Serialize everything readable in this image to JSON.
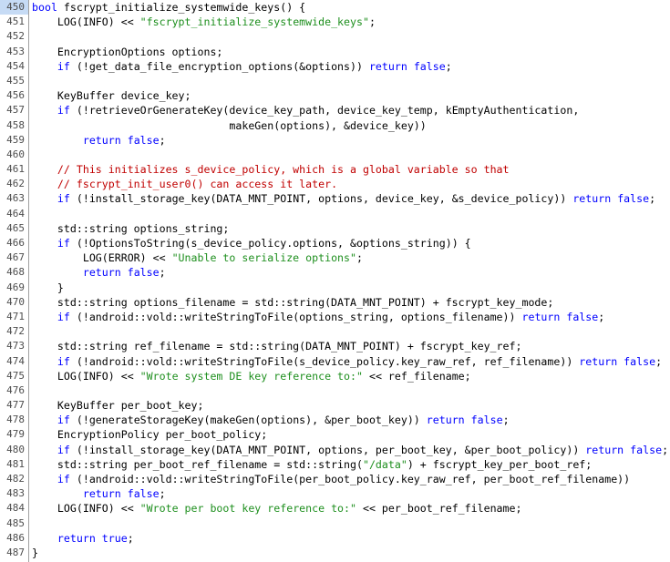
{
  "editor": {
    "current_line": "450",
    "lines": [
      {
        "num": "450",
        "tokens": [
          {
            "t": "kw",
            "v": "bool"
          },
          {
            "t": "p",
            "v": " fscrypt_initialize_systemwide_keys() {"
          }
        ]
      },
      {
        "num": "451",
        "tokens": [
          {
            "t": "p",
            "v": "    LOG(INFO) << "
          },
          {
            "t": "str",
            "v": "\"fscrypt_initialize_systemwide_keys\""
          },
          {
            "t": "p",
            "v": ";"
          }
        ]
      },
      {
        "num": "452",
        "tokens": []
      },
      {
        "num": "453",
        "tokens": [
          {
            "t": "p",
            "v": "    EncryptionOptions options;"
          }
        ]
      },
      {
        "num": "454",
        "tokens": [
          {
            "t": "p",
            "v": "    "
          },
          {
            "t": "kw",
            "v": "if"
          },
          {
            "t": "p",
            "v": " (!get_data_file_encryption_options(&options)) "
          },
          {
            "t": "kw",
            "v": "return"
          },
          {
            "t": "p",
            "v": " "
          },
          {
            "t": "kw",
            "v": "false"
          },
          {
            "t": "p",
            "v": ";"
          }
        ]
      },
      {
        "num": "455",
        "tokens": []
      },
      {
        "num": "456",
        "tokens": [
          {
            "t": "p",
            "v": "    KeyBuffer device_key;"
          }
        ]
      },
      {
        "num": "457",
        "tokens": [
          {
            "t": "p",
            "v": "    "
          },
          {
            "t": "kw",
            "v": "if"
          },
          {
            "t": "p",
            "v": " (!retrieveOrGenerateKey(device_key_path, device_key_temp, kEmptyAuthentication,"
          }
        ]
      },
      {
        "num": "458",
        "tokens": [
          {
            "t": "p",
            "v": "                               makeGen(options), &device_key))"
          }
        ]
      },
      {
        "num": "459",
        "tokens": [
          {
            "t": "p",
            "v": "        "
          },
          {
            "t": "kw",
            "v": "return"
          },
          {
            "t": "p",
            "v": " "
          },
          {
            "t": "kw",
            "v": "false"
          },
          {
            "t": "p",
            "v": ";"
          }
        ]
      },
      {
        "num": "460",
        "tokens": []
      },
      {
        "num": "461",
        "tokens": [
          {
            "t": "p",
            "v": "    "
          },
          {
            "t": "cmt",
            "v": "// This initializes s_device_policy, which is a global variable so that"
          }
        ]
      },
      {
        "num": "462",
        "tokens": [
          {
            "t": "p",
            "v": "    "
          },
          {
            "t": "cmt",
            "v": "// fscrypt_init_user0() can access it later."
          }
        ]
      },
      {
        "num": "463",
        "tokens": [
          {
            "t": "p",
            "v": "    "
          },
          {
            "t": "kw",
            "v": "if"
          },
          {
            "t": "p",
            "v": " (!install_storage_key(DATA_MNT_POINT, options, device_key, &s_device_policy)) "
          },
          {
            "t": "kw",
            "v": "return"
          },
          {
            "t": "p",
            "v": " "
          },
          {
            "t": "kw",
            "v": "false"
          },
          {
            "t": "p",
            "v": ";"
          }
        ]
      },
      {
        "num": "464",
        "tokens": []
      },
      {
        "num": "465",
        "tokens": [
          {
            "t": "p",
            "v": "    std::string options_string;"
          }
        ]
      },
      {
        "num": "466",
        "tokens": [
          {
            "t": "p",
            "v": "    "
          },
          {
            "t": "kw",
            "v": "if"
          },
          {
            "t": "p",
            "v": " (!OptionsToString(s_device_policy.options, &options_string)) {"
          }
        ]
      },
      {
        "num": "467",
        "tokens": [
          {
            "t": "p",
            "v": "        LOG(ERROR) << "
          },
          {
            "t": "str",
            "v": "\"Unable to serialize options\""
          },
          {
            "t": "p",
            "v": ";"
          }
        ]
      },
      {
        "num": "468",
        "tokens": [
          {
            "t": "p",
            "v": "        "
          },
          {
            "t": "kw",
            "v": "return"
          },
          {
            "t": "p",
            "v": " "
          },
          {
            "t": "kw",
            "v": "false"
          },
          {
            "t": "p",
            "v": ";"
          }
        ]
      },
      {
        "num": "469",
        "tokens": [
          {
            "t": "p",
            "v": "    }"
          }
        ]
      },
      {
        "num": "470",
        "tokens": [
          {
            "t": "p",
            "v": "    std::string options_filename = std::string(DATA_MNT_POINT) + fscrypt_key_mode;"
          }
        ]
      },
      {
        "num": "471",
        "tokens": [
          {
            "t": "p",
            "v": "    "
          },
          {
            "t": "kw",
            "v": "if"
          },
          {
            "t": "p",
            "v": " (!android::vold::writeStringToFile(options_string, options_filename)) "
          },
          {
            "t": "kw",
            "v": "return"
          },
          {
            "t": "p",
            "v": " "
          },
          {
            "t": "kw",
            "v": "false"
          },
          {
            "t": "p",
            "v": ";"
          }
        ]
      },
      {
        "num": "472",
        "tokens": []
      },
      {
        "num": "473",
        "tokens": [
          {
            "t": "p",
            "v": "    std::string ref_filename = std::string(DATA_MNT_POINT) + fscrypt_key_ref;"
          }
        ]
      },
      {
        "num": "474",
        "tokens": [
          {
            "t": "p",
            "v": "    "
          },
          {
            "t": "kw",
            "v": "if"
          },
          {
            "t": "p",
            "v": " (!android::vold::writeStringToFile(s_device_policy.key_raw_ref, ref_filename)) "
          },
          {
            "t": "kw",
            "v": "return"
          },
          {
            "t": "p",
            "v": " "
          },
          {
            "t": "kw",
            "v": "false"
          },
          {
            "t": "p",
            "v": ";"
          }
        ]
      },
      {
        "num": "475",
        "tokens": [
          {
            "t": "p",
            "v": "    LOG(INFO) << "
          },
          {
            "t": "str",
            "v": "\"Wrote system DE key reference to:\""
          },
          {
            "t": "p",
            "v": " << ref_filename;"
          }
        ]
      },
      {
        "num": "476",
        "tokens": []
      },
      {
        "num": "477",
        "tokens": [
          {
            "t": "p",
            "v": "    KeyBuffer per_boot_key;"
          }
        ]
      },
      {
        "num": "478",
        "tokens": [
          {
            "t": "p",
            "v": "    "
          },
          {
            "t": "kw",
            "v": "if"
          },
          {
            "t": "p",
            "v": " (!generateStorageKey(makeGen(options), &per_boot_key)) "
          },
          {
            "t": "kw",
            "v": "return"
          },
          {
            "t": "p",
            "v": " "
          },
          {
            "t": "kw",
            "v": "false"
          },
          {
            "t": "p",
            "v": ";"
          }
        ]
      },
      {
        "num": "479",
        "tokens": [
          {
            "t": "p",
            "v": "    EncryptionPolicy per_boot_policy;"
          }
        ]
      },
      {
        "num": "480",
        "tokens": [
          {
            "t": "p",
            "v": "    "
          },
          {
            "t": "kw",
            "v": "if"
          },
          {
            "t": "p",
            "v": " (!install_storage_key(DATA_MNT_POINT, options, per_boot_key, &per_boot_policy)) "
          },
          {
            "t": "kw",
            "v": "return"
          },
          {
            "t": "p",
            "v": " "
          },
          {
            "t": "kw",
            "v": "false"
          },
          {
            "t": "p",
            "v": ";"
          }
        ]
      },
      {
        "num": "481",
        "tokens": [
          {
            "t": "p",
            "v": "    std::string per_boot_ref_filename = std::string("
          },
          {
            "t": "str",
            "v": "\"/data\""
          },
          {
            "t": "p",
            "v": ") + fscrypt_key_per_boot_ref;"
          }
        ]
      },
      {
        "num": "482",
        "tokens": [
          {
            "t": "p",
            "v": "    "
          },
          {
            "t": "kw",
            "v": "if"
          },
          {
            "t": "p",
            "v": " (!android::vold::writeStringToFile(per_boot_policy.key_raw_ref, per_boot_ref_filename))"
          }
        ]
      },
      {
        "num": "483",
        "tokens": [
          {
            "t": "p",
            "v": "        "
          },
          {
            "t": "kw",
            "v": "return"
          },
          {
            "t": "p",
            "v": " "
          },
          {
            "t": "kw",
            "v": "false"
          },
          {
            "t": "p",
            "v": ";"
          }
        ]
      },
      {
        "num": "484",
        "tokens": [
          {
            "t": "p",
            "v": "    LOG(INFO) << "
          },
          {
            "t": "str",
            "v": "\"Wrote per boot key reference to:\""
          },
          {
            "t": "p",
            "v": " << per_boot_ref_filename;"
          }
        ]
      },
      {
        "num": "485",
        "tokens": []
      },
      {
        "num": "486",
        "tokens": [
          {
            "t": "p",
            "v": "    "
          },
          {
            "t": "kw",
            "v": "return"
          },
          {
            "t": "p",
            "v": " "
          },
          {
            "t": "kw",
            "v": "true"
          },
          {
            "t": "p",
            "v": ";"
          }
        ]
      },
      {
        "num": "487",
        "tokens": [
          {
            "t": "p",
            "v": "}"
          }
        ]
      }
    ]
  }
}
